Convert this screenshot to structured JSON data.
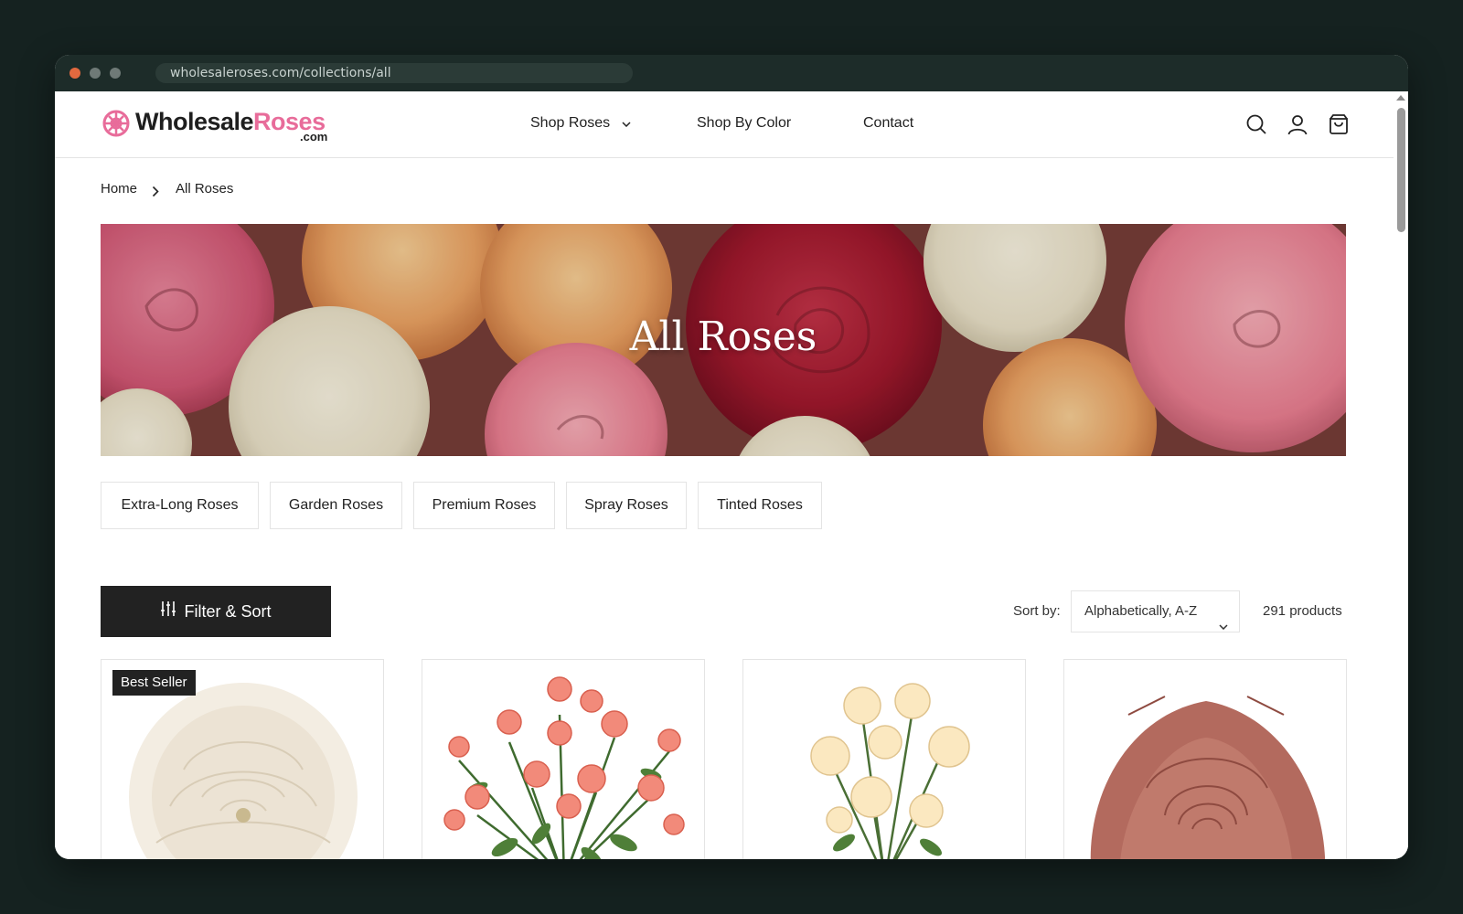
{
  "browser": {
    "url": "wholesaleroses.com/collections/all"
  },
  "header": {
    "logo": {
      "text_main": "Wholesale",
      "text_accent": "Roses",
      "text_suffix": ".com"
    },
    "nav": [
      {
        "label": "Shop Roses",
        "has_dropdown": true
      },
      {
        "label": "Shop By Color"
      },
      {
        "label": "Contact"
      }
    ],
    "icons": [
      "search-icon",
      "account-icon",
      "cart-icon"
    ]
  },
  "breadcrumb": {
    "home": "Home",
    "current": "All Roses"
  },
  "hero": {
    "title": "All Roses"
  },
  "subcategories": [
    "Extra-Long Roses",
    "Garden Roses",
    "Premium Roses",
    "Spray Roses",
    "Tinted Roses"
  ],
  "toolbar": {
    "filter_label": "Filter & Sort",
    "sort_label": "Sort by:",
    "sort_value": "Alphabetically, A-Z",
    "product_count": "291 products"
  },
  "products": [
    {
      "badge": "Best Seller",
      "image": "white-garden-rose"
    },
    {
      "image": "peach-spray-roses"
    },
    {
      "image": "cream-spray-roses"
    },
    {
      "image": "dusty-rose-bloom"
    }
  ],
  "colors": {
    "brand_pink": "#e86c9a",
    "dark_button": "#222222",
    "page_bg": "#152220"
  }
}
